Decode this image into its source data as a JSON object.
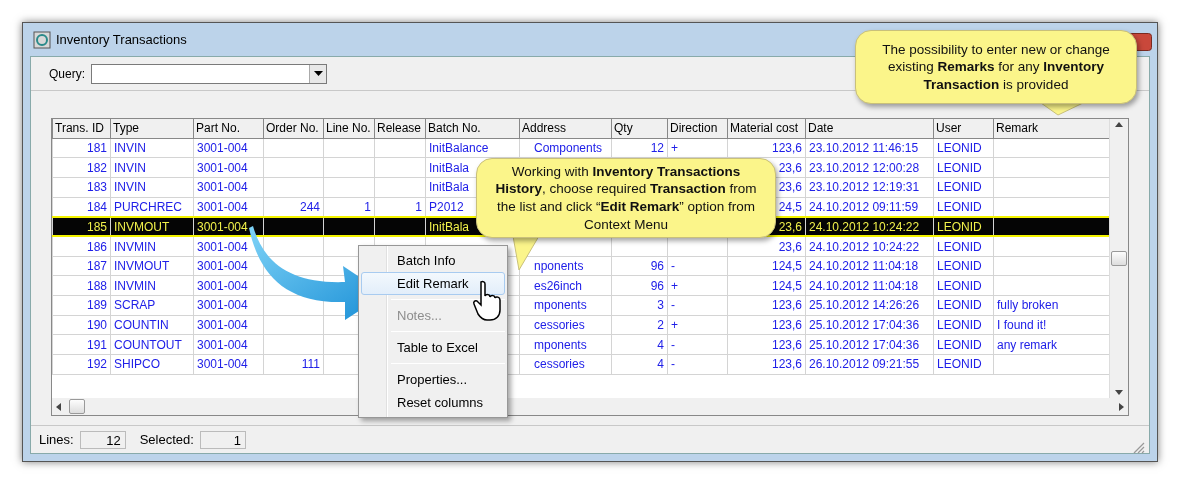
{
  "window": {
    "title": "Inventory Transactions"
  },
  "query": {
    "label": "Query:"
  },
  "table": {
    "columns": [
      {
        "label": "Trans. ID"
      },
      {
        "label": "Type"
      },
      {
        "label": "Part No."
      },
      {
        "label": "Order No."
      },
      {
        "label": "Line No."
      },
      {
        "label": "Release"
      },
      {
        "label": "Batch No."
      },
      {
        "label": "Address"
      },
      {
        "label": "Qty"
      },
      {
        "label": "Direction"
      },
      {
        "label": "Material cost"
      },
      {
        "label": "Date"
      },
      {
        "label": "User"
      },
      {
        "label": "Remark"
      }
    ],
    "rows": [
      {
        "selected": false,
        "trans_id": "181",
        "type": "INVIN",
        "part_no": "3001-004",
        "batch_no": "InitBalance",
        "address": "Components",
        "qty": "12",
        "direction": "+",
        "material_cost": "123,6",
        "date": "23.10.2012 11:46:15",
        "user": "LEONID"
      },
      {
        "selected": false,
        "trans_id": "182",
        "type": "INVIN",
        "part_no": "3001-004",
        "batch_no": "InitBala",
        "material_cost": "23,6",
        "date": "23.10.2012 12:00:28",
        "user": "LEONID"
      },
      {
        "selected": false,
        "trans_id": "183",
        "type": "INVIN",
        "part_no": "3001-004",
        "batch_no": "InitBala",
        "material_cost": "23,6",
        "date": "23.10.2012 12:19:31",
        "user": "LEONID"
      },
      {
        "selected": false,
        "trans_id": "184",
        "type": "PURCHREC",
        "part_no": "3001-004",
        "order_no": "244",
        "line_no": "1",
        "release": "1",
        "batch_no": "P2012",
        "material_cost": "24,5",
        "date": "24.10.2012 09:11:59",
        "user": "LEONID"
      },
      {
        "selected": true,
        "trans_id": "185",
        "type": "INVMOUT",
        "part_no": "3001-004",
        "batch_no": "InitBala",
        "material_cost": "23,6",
        "date": "24.10.2012 10:24:22",
        "user": "LEONID"
      },
      {
        "selected": false,
        "trans_id": "186",
        "type": "INVMIN",
        "part_no": "3001-004",
        "material_cost": "23,6",
        "date": "24.10.2012 10:24:22",
        "user": "LEONID"
      },
      {
        "selected": false,
        "trans_id": "187",
        "type": "INVMOUT",
        "part_no": "3001-004",
        "address": "nponents",
        "qty": "96",
        "direction": "-",
        "material_cost": "124,5",
        "date": "24.10.2012 11:04:18",
        "user": "LEONID"
      },
      {
        "selected": false,
        "trans_id": "188",
        "type": "INVMIN",
        "part_no": "3001-004",
        "address": "es26inch",
        "qty": "96",
        "direction": "+",
        "material_cost": "124,5",
        "date": "24.10.2012 11:04:18",
        "user": "LEONID"
      },
      {
        "selected": false,
        "trans_id": "189",
        "type": "SCRAP",
        "part_no": "3001-004",
        "address": "mponents",
        "qty": "3",
        "direction": "-",
        "material_cost": "123,6",
        "date": "25.10.2012 14:26:26",
        "user": "LEONID",
        "remark": "fully broken"
      },
      {
        "selected": false,
        "trans_id": "190",
        "type": "COUNTIN",
        "part_no": "3001-004",
        "address": "cessories",
        "qty": "2",
        "direction": "+",
        "material_cost": "123,6",
        "date": "25.10.2012 17:04:36",
        "user": "LEONID",
        "remark": "I found it!"
      },
      {
        "selected": false,
        "trans_id": "191",
        "type": "COUNTOUT",
        "part_no": "3001-004",
        "address": "mponents",
        "qty": "4",
        "direction": "-",
        "material_cost": "123,6",
        "date": "25.10.2012 17:04:36",
        "user": "LEONID",
        "remark": "any remark"
      },
      {
        "selected": false,
        "trans_id": "192",
        "type": "SHIPCO",
        "part_no": "3001-004",
        "order_no": "111",
        "address": "cessories",
        "qty": "4",
        "direction": "-",
        "material_cost": "123,6",
        "date": "26.10.2012 09:21:55",
        "user": "LEONID"
      }
    ]
  },
  "context_menu": {
    "items": [
      {
        "kind": "item",
        "label": "Batch Info",
        "selected": false,
        "disabled": false
      },
      {
        "kind": "item",
        "label": "Edit Remark",
        "selected": true,
        "disabled": false
      },
      {
        "kind": "separator"
      },
      {
        "kind": "item",
        "label": "Notes...",
        "selected": false,
        "disabled": true
      },
      {
        "kind": "separator"
      },
      {
        "kind": "item",
        "label": "Table to Excel",
        "selected": false,
        "disabled": false
      },
      {
        "kind": "separator"
      },
      {
        "kind": "item",
        "label": "Properties...",
        "selected": false,
        "disabled": false
      },
      {
        "kind": "item",
        "label": "Reset columns",
        "selected": false,
        "disabled": false
      }
    ]
  },
  "status_bar": {
    "lines_label": "Lines:",
    "lines_value": "12",
    "selected_label": "Selected:",
    "selected_value": "1"
  },
  "callouts": [
    {
      "text": "Working with **Inventory Transactions History**, choose required **Transaction** from the list and click “**Edit Remark**” option from Context Menu"
    },
    {
      "text": "The possibility to enter new or change existing **Remarks** for any **Inventory Transaction**  is provided"
    }
  ]
}
